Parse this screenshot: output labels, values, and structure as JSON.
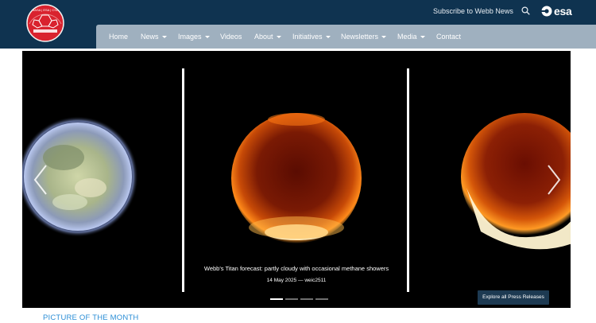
{
  "header": {
    "logo_text": "NASA | ESA | CSA",
    "subscribe_label": "Subscribe to Webb News",
    "search_icon": "search-icon",
    "esa_label": "esa"
  },
  "nav": {
    "items": [
      {
        "label": "Home",
        "dropdown": false
      },
      {
        "label": "News",
        "dropdown": true
      },
      {
        "label": "Images",
        "dropdown": true
      },
      {
        "label": "Videos",
        "dropdown": false
      },
      {
        "label": "About",
        "dropdown": true
      },
      {
        "label": "Initiatives",
        "dropdown": true
      },
      {
        "label": "Newsletters",
        "dropdown": true
      },
      {
        "label": "Media",
        "dropdown": true
      },
      {
        "label": "Contact",
        "dropdown": false
      }
    ]
  },
  "carousel": {
    "caption_title": "Webb's Titan forecast: partly cloudy with occasional methane showers",
    "caption_meta": "14 May 2025 — weic2511",
    "explore_label": "Explore all Press Releases",
    "prev_icon": "chevron-left-icon",
    "next_icon": "chevron-right-icon",
    "slide_count": 4,
    "active_slide": 1
  },
  "section": {
    "picture_of_month": "PICTURE OF THE MONTH"
  },
  "colors": {
    "header_bg": "#0f3350",
    "nav_bg": "#9fb0bf",
    "link_blue": "#2b8ed6",
    "button_bg": "#1d3a52"
  }
}
